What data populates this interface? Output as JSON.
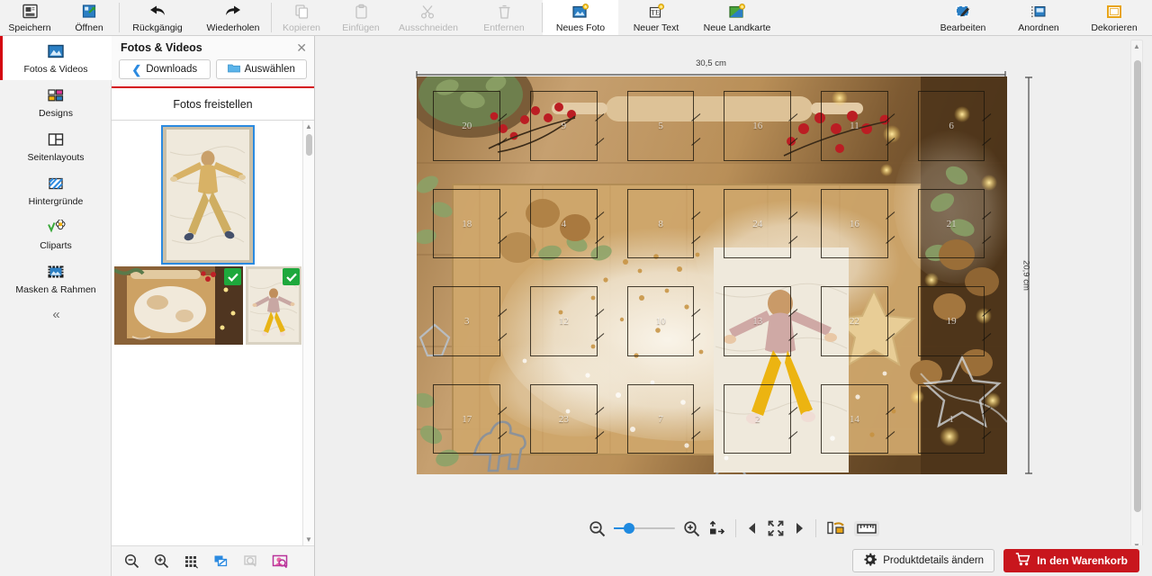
{
  "toolbar": {
    "groups": [
      {
        "name": "file",
        "buttons": [
          {
            "label": "Speichern",
            "icon": "save-icon",
            "disabled": false
          },
          {
            "label": "Öffnen",
            "icon": "open-icon",
            "disabled": false
          }
        ]
      },
      {
        "name": "history",
        "buttons": [
          {
            "label": "Rückgängig",
            "icon": "undo-arrow-icon",
            "disabled": false
          },
          {
            "label": "Wiederholen",
            "icon": "redo-arrow-icon",
            "disabled": false
          }
        ]
      },
      {
        "name": "clipboard",
        "buttons": [
          {
            "label": "Kopieren",
            "icon": "copy-icon",
            "disabled": true
          },
          {
            "label": "Einfügen",
            "icon": "paste-icon",
            "disabled": true
          },
          {
            "label": "Ausschneiden",
            "icon": "scissors-icon",
            "disabled": true
          },
          {
            "label": "Entfernen",
            "icon": "trash-icon",
            "disabled": true
          }
        ]
      },
      {
        "name": "insert",
        "buttons": [
          {
            "label": "Neues Foto",
            "icon": "new-photo-icon",
            "disabled": false,
            "active": true
          },
          {
            "label": "Neuer Text",
            "icon": "new-text-icon",
            "disabled": false
          },
          {
            "label": "Neue Landkarte",
            "icon": "new-map-icon",
            "disabled": false
          }
        ]
      },
      {
        "name": "modes",
        "buttons": [
          {
            "label": "Bearbeiten",
            "icon": "edit-pencil-icon",
            "disabled": false
          },
          {
            "label": "Anordnen",
            "icon": "arrange-icon",
            "disabled": false
          },
          {
            "label": "Dekorieren",
            "icon": "decorate-frame-icon",
            "disabled": false
          }
        ]
      }
    ]
  },
  "sidebar": {
    "items": [
      {
        "label": "Fotos & Videos",
        "icon": "photo-icon",
        "selected": true
      },
      {
        "label": "Designs",
        "icon": "designs-grid-icon",
        "selected": false
      },
      {
        "label": "Seitenlayouts",
        "icon": "page-layout-icon",
        "selected": false
      },
      {
        "label": "Hintergründe",
        "icon": "background-stripes-icon",
        "selected": false
      },
      {
        "label": "Cliparts",
        "icon": "clipart-flower-icon",
        "selected": false
      },
      {
        "label": "Masken & Rahmen",
        "icon": "mask-frame-icon",
        "selected": false
      }
    ],
    "collapse_label": "«"
  },
  "panel": {
    "title": "Fotos & Videos",
    "close_icon": "close-icon",
    "browse_label": "Downloads",
    "browse_icon": "chevron-left-icon",
    "select_label": "Auswählen",
    "select_icon": "folder-icon",
    "cutout_label": "Fotos freistellen",
    "thumbnails": [
      {
        "name": "person-on-blanket-yellow",
        "selected": true,
        "used": false
      },
      {
        "name": "flour-board-christmas",
        "selected": false,
        "used": true
      },
      {
        "name": "child-on-blanket-yellow",
        "selected": false,
        "used": true
      }
    ],
    "footer_icons": [
      "zoom-out-icon",
      "zoom-in-icon",
      "grid-view-icon",
      "overlay-icon",
      "search-image-icon",
      "face-search-icon"
    ]
  },
  "canvas": {
    "width_label": "30,5 cm",
    "height_label": "20,9 cm",
    "doors": [
      "20",
      "9",
      "5",
      "16",
      "11",
      "6",
      "18",
      "4",
      "8",
      "24",
      "16",
      "21",
      "3",
      "12",
      "10",
      "13",
      "22",
      "19",
      "17",
      "23",
      "7",
      "2",
      "14",
      "1"
    ]
  },
  "canvas_tools": {
    "zoom_out_icon": "zoom-out-icon",
    "zoom_in_icon": "zoom-in-icon",
    "zoom_value": 20,
    "fit_icon": "fit-to-page-icon",
    "prev_icon": "previous-page-icon",
    "fullscreen_icon": "fullscreen-icon",
    "next_icon": "next-page-icon",
    "spread_icon": "page-spread-icon",
    "ruler_icon": "ruler-icon"
  },
  "bottom": {
    "details_label": "Produktdetails ändern",
    "details_icon": "gear-icon",
    "cart_label": "In den Warenkorb",
    "cart_icon": "cart-icon",
    "cart_color": "#c8161d"
  },
  "colors": {
    "accent_red": "#d40511",
    "cart_red": "#c8161d",
    "select_blue": "#2b8ae0",
    "check_green": "#1ea83c",
    "toolbar_bg": "#f2f2f2",
    "stage_bg": "#efefef"
  }
}
